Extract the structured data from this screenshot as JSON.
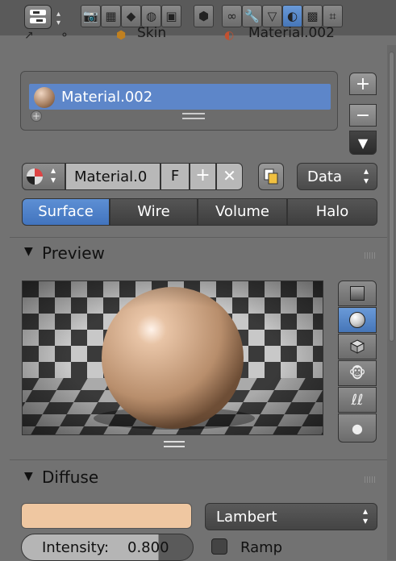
{
  "header": {
    "context_icons": [
      "render-icon",
      "render-layers-icon",
      "scene-icon",
      "world-icon",
      "object-icon",
      "constraints-icon",
      "modifiers-icon",
      "data-icon",
      "material-icon",
      "texture-icon",
      "particles-icon"
    ],
    "active_context": "material-icon"
  },
  "breadcrumb": {
    "object": "Skin",
    "material": "Material.002"
  },
  "material_slots": {
    "items": [
      {
        "name": "Material.002"
      }
    ],
    "add_symbol": "+",
    "remove_symbol": "−",
    "menu_symbol": "▼"
  },
  "datablock": {
    "material_name": "Material.0",
    "fake_user": "F",
    "new_symbol": "+",
    "unlink_symbol": "✕",
    "link_type": "Data"
  },
  "tabs": [
    {
      "label": "Surface",
      "active": true
    },
    {
      "label": "Wire",
      "active": false
    },
    {
      "label": "Volume",
      "active": false
    },
    {
      "label": "Halo",
      "active": false
    }
  ],
  "preview": {
    "title": "Preview",
    "types": [
      "flat-icon",
      "sphere-icon",
      "cube-icon",
      "monkey-icon",
      "hair-icon",
      "sphere-monkey-icon"
    ],
    "active_type": "sphere-icon"
  },
  "diffuse": {
    "title": "Diffuse",
    "color": "#efc7a1",
    "shader": "Lambert",
    "intensity_label": "Intensity:",
    "intensity_value": "0.800",
    "intensity_fraction": 0.8,
    "ramp_label": "Ramp",
    "ramp_checked": false
  },
  "colors": {
    "accent": "#5680c6",
    "panel": "#727272",
    "header": "#5a5a5a"
  }
}
